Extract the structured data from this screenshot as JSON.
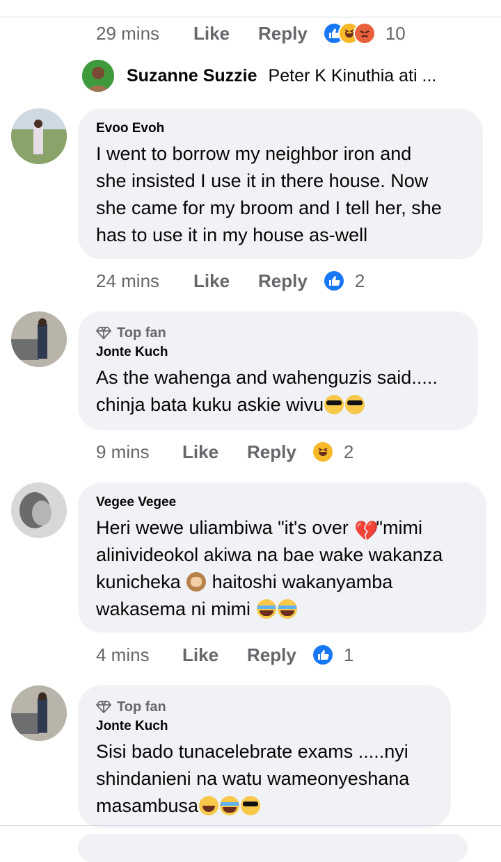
{
  "first_meta": {
    "time": "29 mins",
    "like": "Like",
    "reply": "Reply",
    "count": "10",
    "reactions": [
      "like",
      "haha",
      "angry"
    ]
  },
  "subreply": {
    "name": "Suzanne Suzzie",
    "text": "Peter K Kinuthia ati ..."
  },
  "comments": [
    {
      "name": "Evoo Evoh",
      "top_fan": "",
      "lines": [
        "I went to borrow my neighbor iron and",
        "she insisted I use it in there house. Now",
        "she came for my broom and I tell her, she",
        "has to use it in my house as-well"
      ],
      "time": "24 mins",
      "like": "Like",
      "reply": "Reply",
      "count": "2",
      "reaction": "like"
    },
    {
      "name": "Jonte Kuch",
      "top_fan": "Top fan",
      "lines": [
        "As the wahenga and wahenguzis said.....",
        "chinja bata kuku askie wivu"
      ],
      "time": "9 mins",
      "like": "Like",
      "reply": "Reply",
      "count": "2",
      "reaction": "haha"
    },
    {
      "name": "Vegee Vegee",
      "top_fan": "",
      "lines": [
        "Heri wewe uliambiwa \"it's over",
        "\"mimi",
        "alinivideokol akiwa na bae wake wakanza",
        "kunicheka",
        "haitoshi wakanyamba",
        "wakasema ni mimi"
      ],
      "time": "4 mins",
      "like": "Like",
      "reply": "Reply",
      "count": "1",
      "reaction": "like"
    },
    {
      "name": "Jonte Kuch",
      "top_fan": "Top fan",
      "lines": [
        "Sisi bado tunacelebrate exams .....nyi",
        "shindanieni na watu wameonyeshana",
        "masambusa"
      ]
    }
  ],
  "colors": {
    "bubble": "#f0f2f5",
    "meta_text": "#65676b",
    "like_blue": "#1877f2",
    "haha_yellow": "#f7b928",
    "angry_orange": "#e8603c"
  },
  "icons": [
    "like-reaction-icon",
    "haha-reaction-icon",
    "angry-reaction-icon",
    "top-fan-diamond-icon"
  ]
}
